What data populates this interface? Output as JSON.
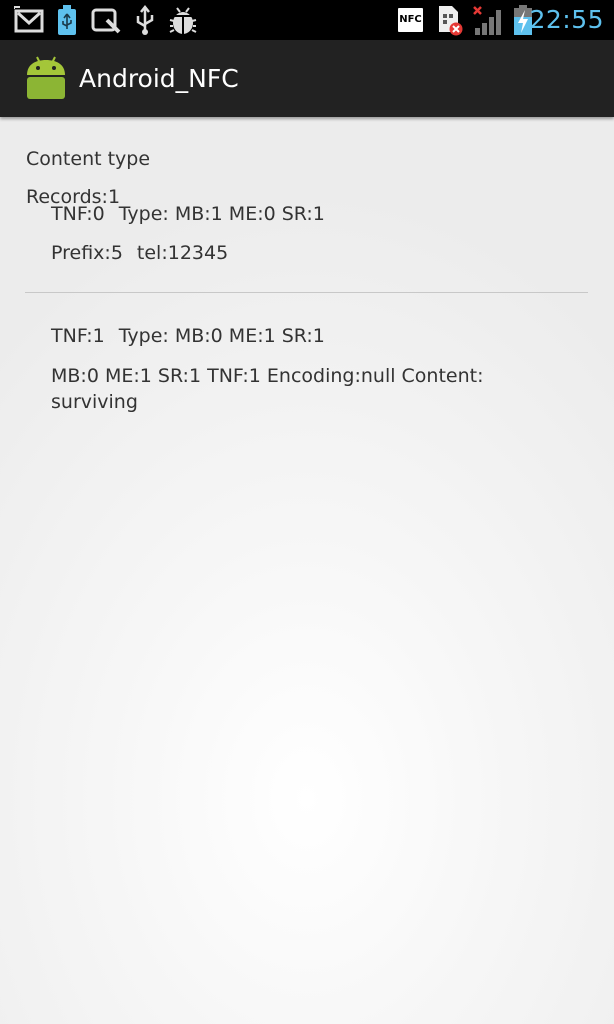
{
  "status_bar": {
    "time": "22:55",
    "time_color": "#5ec1ee",
    "nfc_badge": "NFC",
    "left_icons": [
      "gmail-icon",
      "usb-storage-icon",
      "quickmemo-icon",
      "usb-icon",
      "debug-icon"
    ],
    "right_icons": [
      "nfc-icon",
      "no-sim-icon",
      "signal-no-service-icon",
      "battery-charging-icon"
    ]
  },
  "action_bar": {
    "title": "Android_NFC",
    "icon": "android-robot-icon",
    "background": "#222222"
  },
  "content": {
    "content_type_label": "Content type",
    "records_label": "Records:1",
    "records": [
      {
        "tnf": "TNF:0",
        "type_flags": "Type: MB:1 ME:0 SR:1",
        "prefix": "Prefix:5",
        "value": "tel:12345"
      },
      {
        "tnf": "TNF:1",
        "type_flags": "Type: MB:0 ME:1 SR:1",
        "detail": "MB:0 ME:1 SR:1 TNF:1 Encoding:null Content: surviving"
      }
    ]
  }
}
